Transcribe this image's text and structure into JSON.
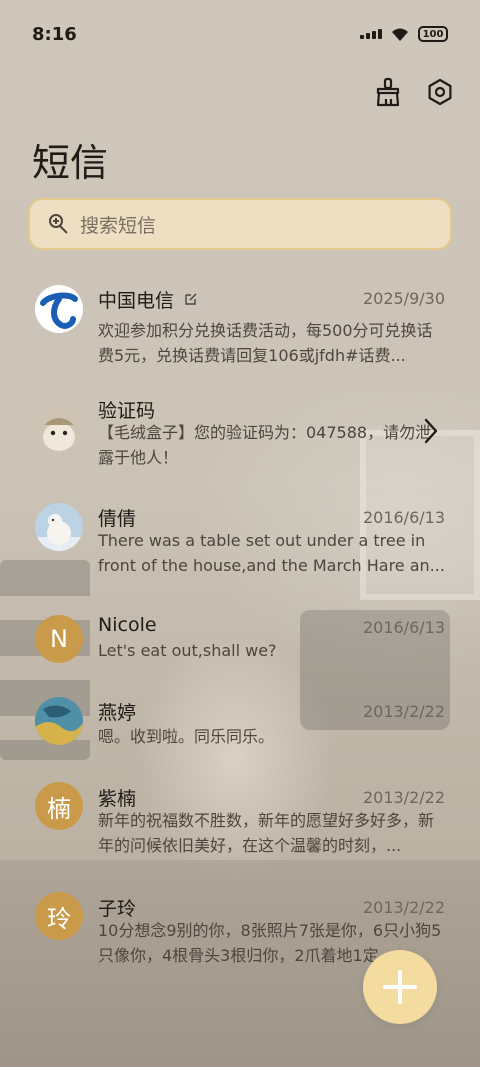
{
  "status_bar": {
    "time": "8:16",
    "battery": "100"
  },
  "header": {
    "title": "短信",
    "icons": [
      "broom-icon",
      "settings-hex-icon"
    ]
  },
  "search": {
    "placeholder": "搜索短信"
  },
  "conversations": [
    {
      "name": "中国电信",
      "date": "2025/9/30",
      "preview": "欢迎参加积分兑换话费活动，每500分可兑换话费5元，兑换话费请回复106或jfdh#话费...",
      "avatar": "china-telecom-logo"
    },
    {
      "name": "验证码",
      "date": "",
      "preview": "【毛绒盒子】您的验证码为：047588，请勿泄露于他人！",
      "avatar": "hamster-photo"
    },
    {
      "name": "倩倩",
      "date": "2016/6/13",
      "preview": "There was a table set out under a tree in front of the house,and the March Hare an...",
      "avatar": "polar-bear-photo"
    },
    {
      "name": "Nicole",
      "date": "2016/6/13",
      "preview": "Let's eat out,shall we?",
      "avatar_letter": "N"
    },
    {
      "name": "燕婷",
      "date": "2013/2/22",
      "preview": "嗯。收到啦。同乐同乐。",
      "avatar": "painting-photo"
    },
    {
      "name": "紫楠",
      "date": "2013/2/22",
      "preview": "新年的祝福数不胜数，新年的愿望好多好多，新年的问候依旧美好，在这个温馨的时刻，...",
      "avatar_letter": "楠"
    },
    {
      "name": "子玲",
      "date": "2013/2/22",
      "preview": "10分想念9别的你，8张照片7张是你，6只小狗5只像你，4根骨头3根归你，2爪着地1定...",
      "avatar_letter": "玲"
    }
  ],
  "fab": {
    "icon": "plus-icon"
  },
  "colors": {
    "accent": "#f4dca0",
    "search_bg": "#eedfc3",
    "letter_avatar": "#c99a4a"
  }
}
